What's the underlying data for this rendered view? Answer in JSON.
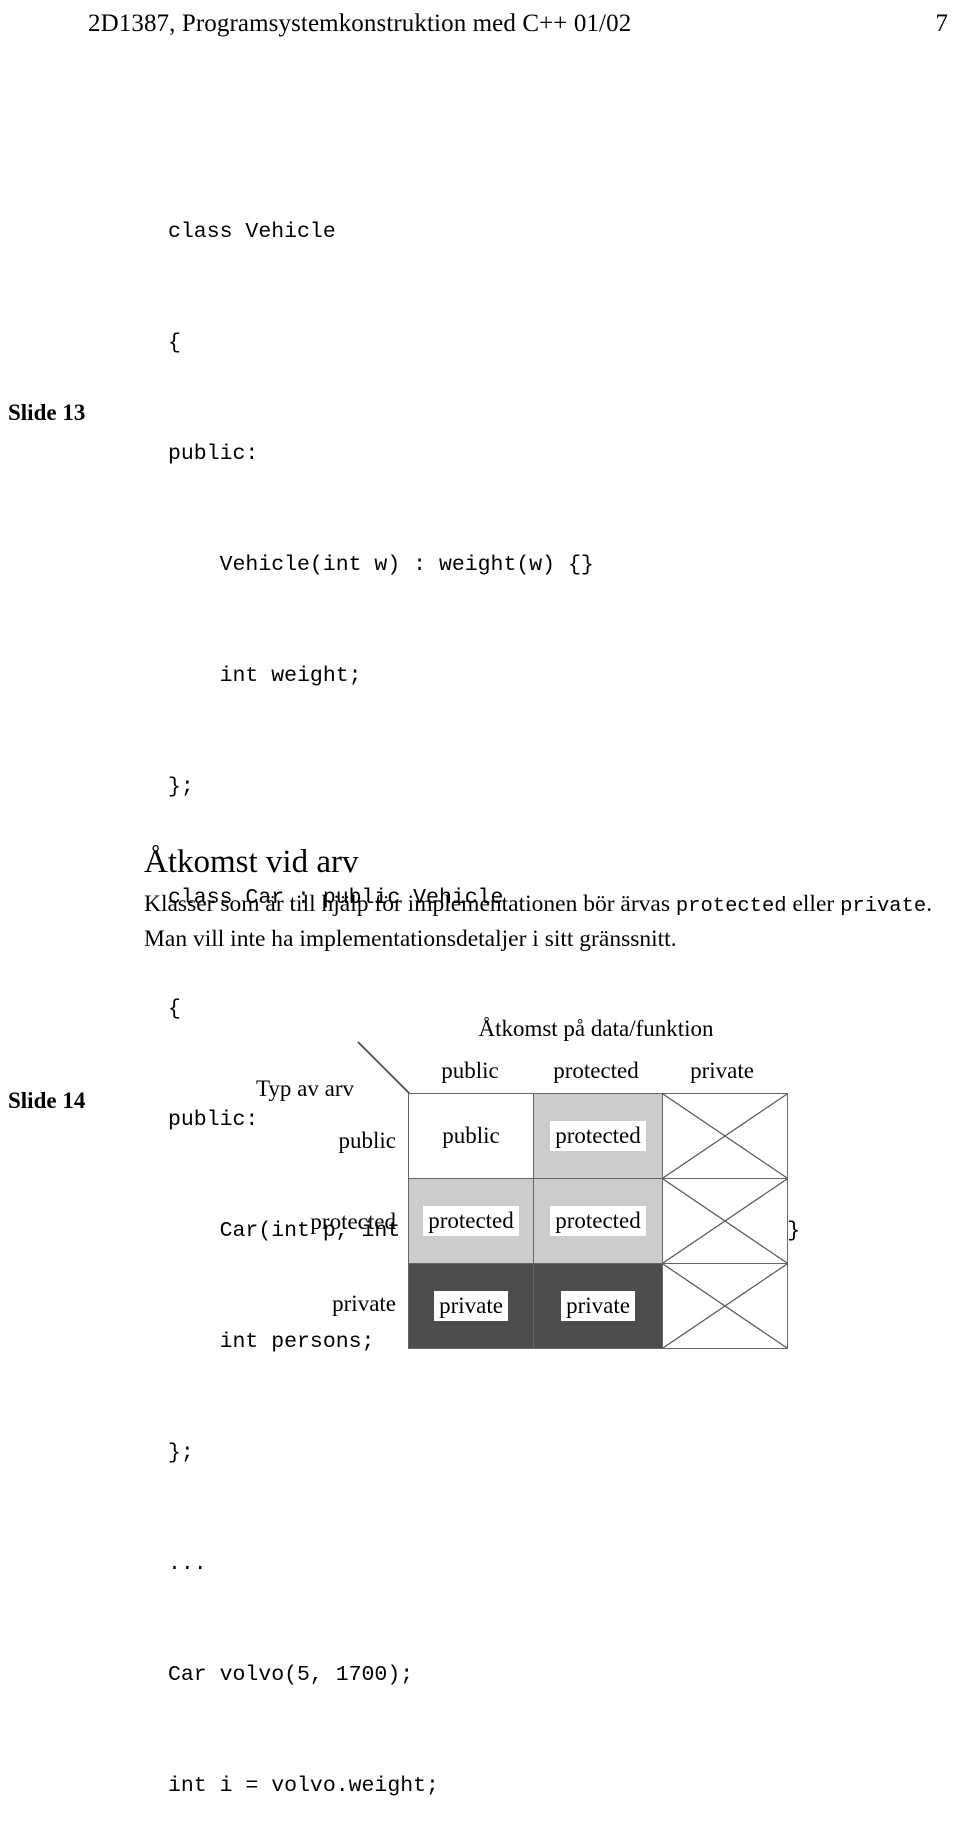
{
  "header": {
    "title": "2D1387, Programsystemkonstruktion med C++ 01/02",
    "page_number": "7"
  },
  "slide13": {
    "label": "Slide 13",
    "code_lines": [
      "class Vehicle",
      "{",
      "public:",
      "    Vehicle(int w) : weight(w) {}",
      "    int weight;",
      "};",
      "class Car : public Vehicle",
      "{",
      "public:",
      "    Car(int p, int w) : Vehicle(w), persons(p) {}",
      "    int persons;",
      "};",
      "...",
      "Car volvo(5, 1700);",
      "int i = volvo.weight;"
    ]
  },
  "slide14": {
    "label": "Slide 14",
    "heading": "Åtkomst vid arv",
    "body_part1": "Klasser som är till hjälp för implementationen bör ärvas ",
    "body_keyword1": "protected",
    "body_part2": " eller ",
    "body_keyword2": "private",
    "body_part3": ". Man vill inte ha implementationsdetaljer i sitt gränssnitt.",
    "table": {
      "column_axis_title": "Åtkomst på data/funktion",
      "row_axis_title": "Typ av arv",
      "column_headers": [
        "public",
        "protected",
        "private"
      ],
      "row_headers": [
        "public",
        "protected",
        "private"
      ],
      "cells": [
        [
          {
            "text": "public",
            "fill": "white"
          },
          {
            "text": "protected",
            "fill": "light"
          },
          {
            "text": "",
            "fill": "cross"
          }
        ],
        [
          {
            "text": "protected",
            "fill": "light"
          },
          {
            "text": "protected",
            "fill": "light"
          },
          {
            "text": "",
            "fill": "cross"
          }
        ],
        [
          {
            "text": "private",
            "fill": "dark"
          },
          {
            "text": "private",
            "fill": "dark"
          },
          {
            "text": "",
            "fill": "cross"
          }
        ]
      ],
      "colors": {
        "white": "#ffffff",
        "light": "#cccccc",
        "dark": "#4d4d4d",
        "border": "#666666"
      }
    }
  }
}
